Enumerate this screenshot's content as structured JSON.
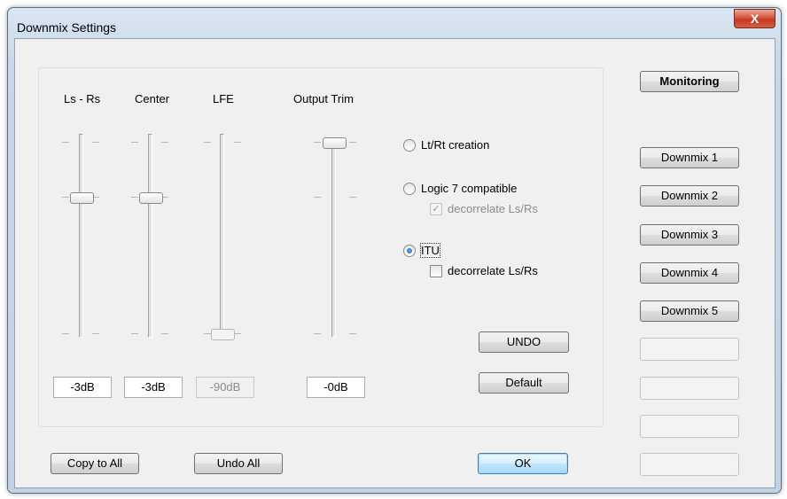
{
  "window": {
    "title": "Downmix Settings",
    "close_glyph": "X"
  },
  "channels": [
    {
      "label": "Ls - Rs",
      "value": "-3dB",
      "enabled": true
    },
    {
      "label": "Center",
      "value": "-3dB",
      "enabled": true
    },
    {
      "label": "LFE",
      "value": "-90dB",
      "enabled": false
    },
    {
      "label": "Output Trim",
      "value": "-0dB",
      "enabled": true
    }
  ],
  "modes": [
    {
      "label": "Lt/Rt creation",
      "selected": false
    },
    {
      "label": "Logic 7 compatible",
      "selected": false,
      "decorrelate": {
        "label": "decorrelate Ls/Rs",
        "checked": true,
        "enabled": false
      }
    },
    {
      "label": "ITU",
      "selected": true,
      "decorrelate": {
        "label": "decorrelate Ls/Rs",
        "checked": false,
        "enabled": true
      }
    }
  ],
  "buttons": {
    "undo": "UNDO",
    "default": "Default",
    "copy_to_all": "Copy to All",
    "undo_all": "Undo All",
    "ok": "OK",
    "monitoring": "Monitoring"
  },
  "presets": [
    "Downmix 1",
    "Downmix 2",
    "Downmix 3",
    "Downmix 4",
    "Downmix 5",
    "",
    "",
    "",
    ""
  ],
  "check_glyph": "✓"
}
